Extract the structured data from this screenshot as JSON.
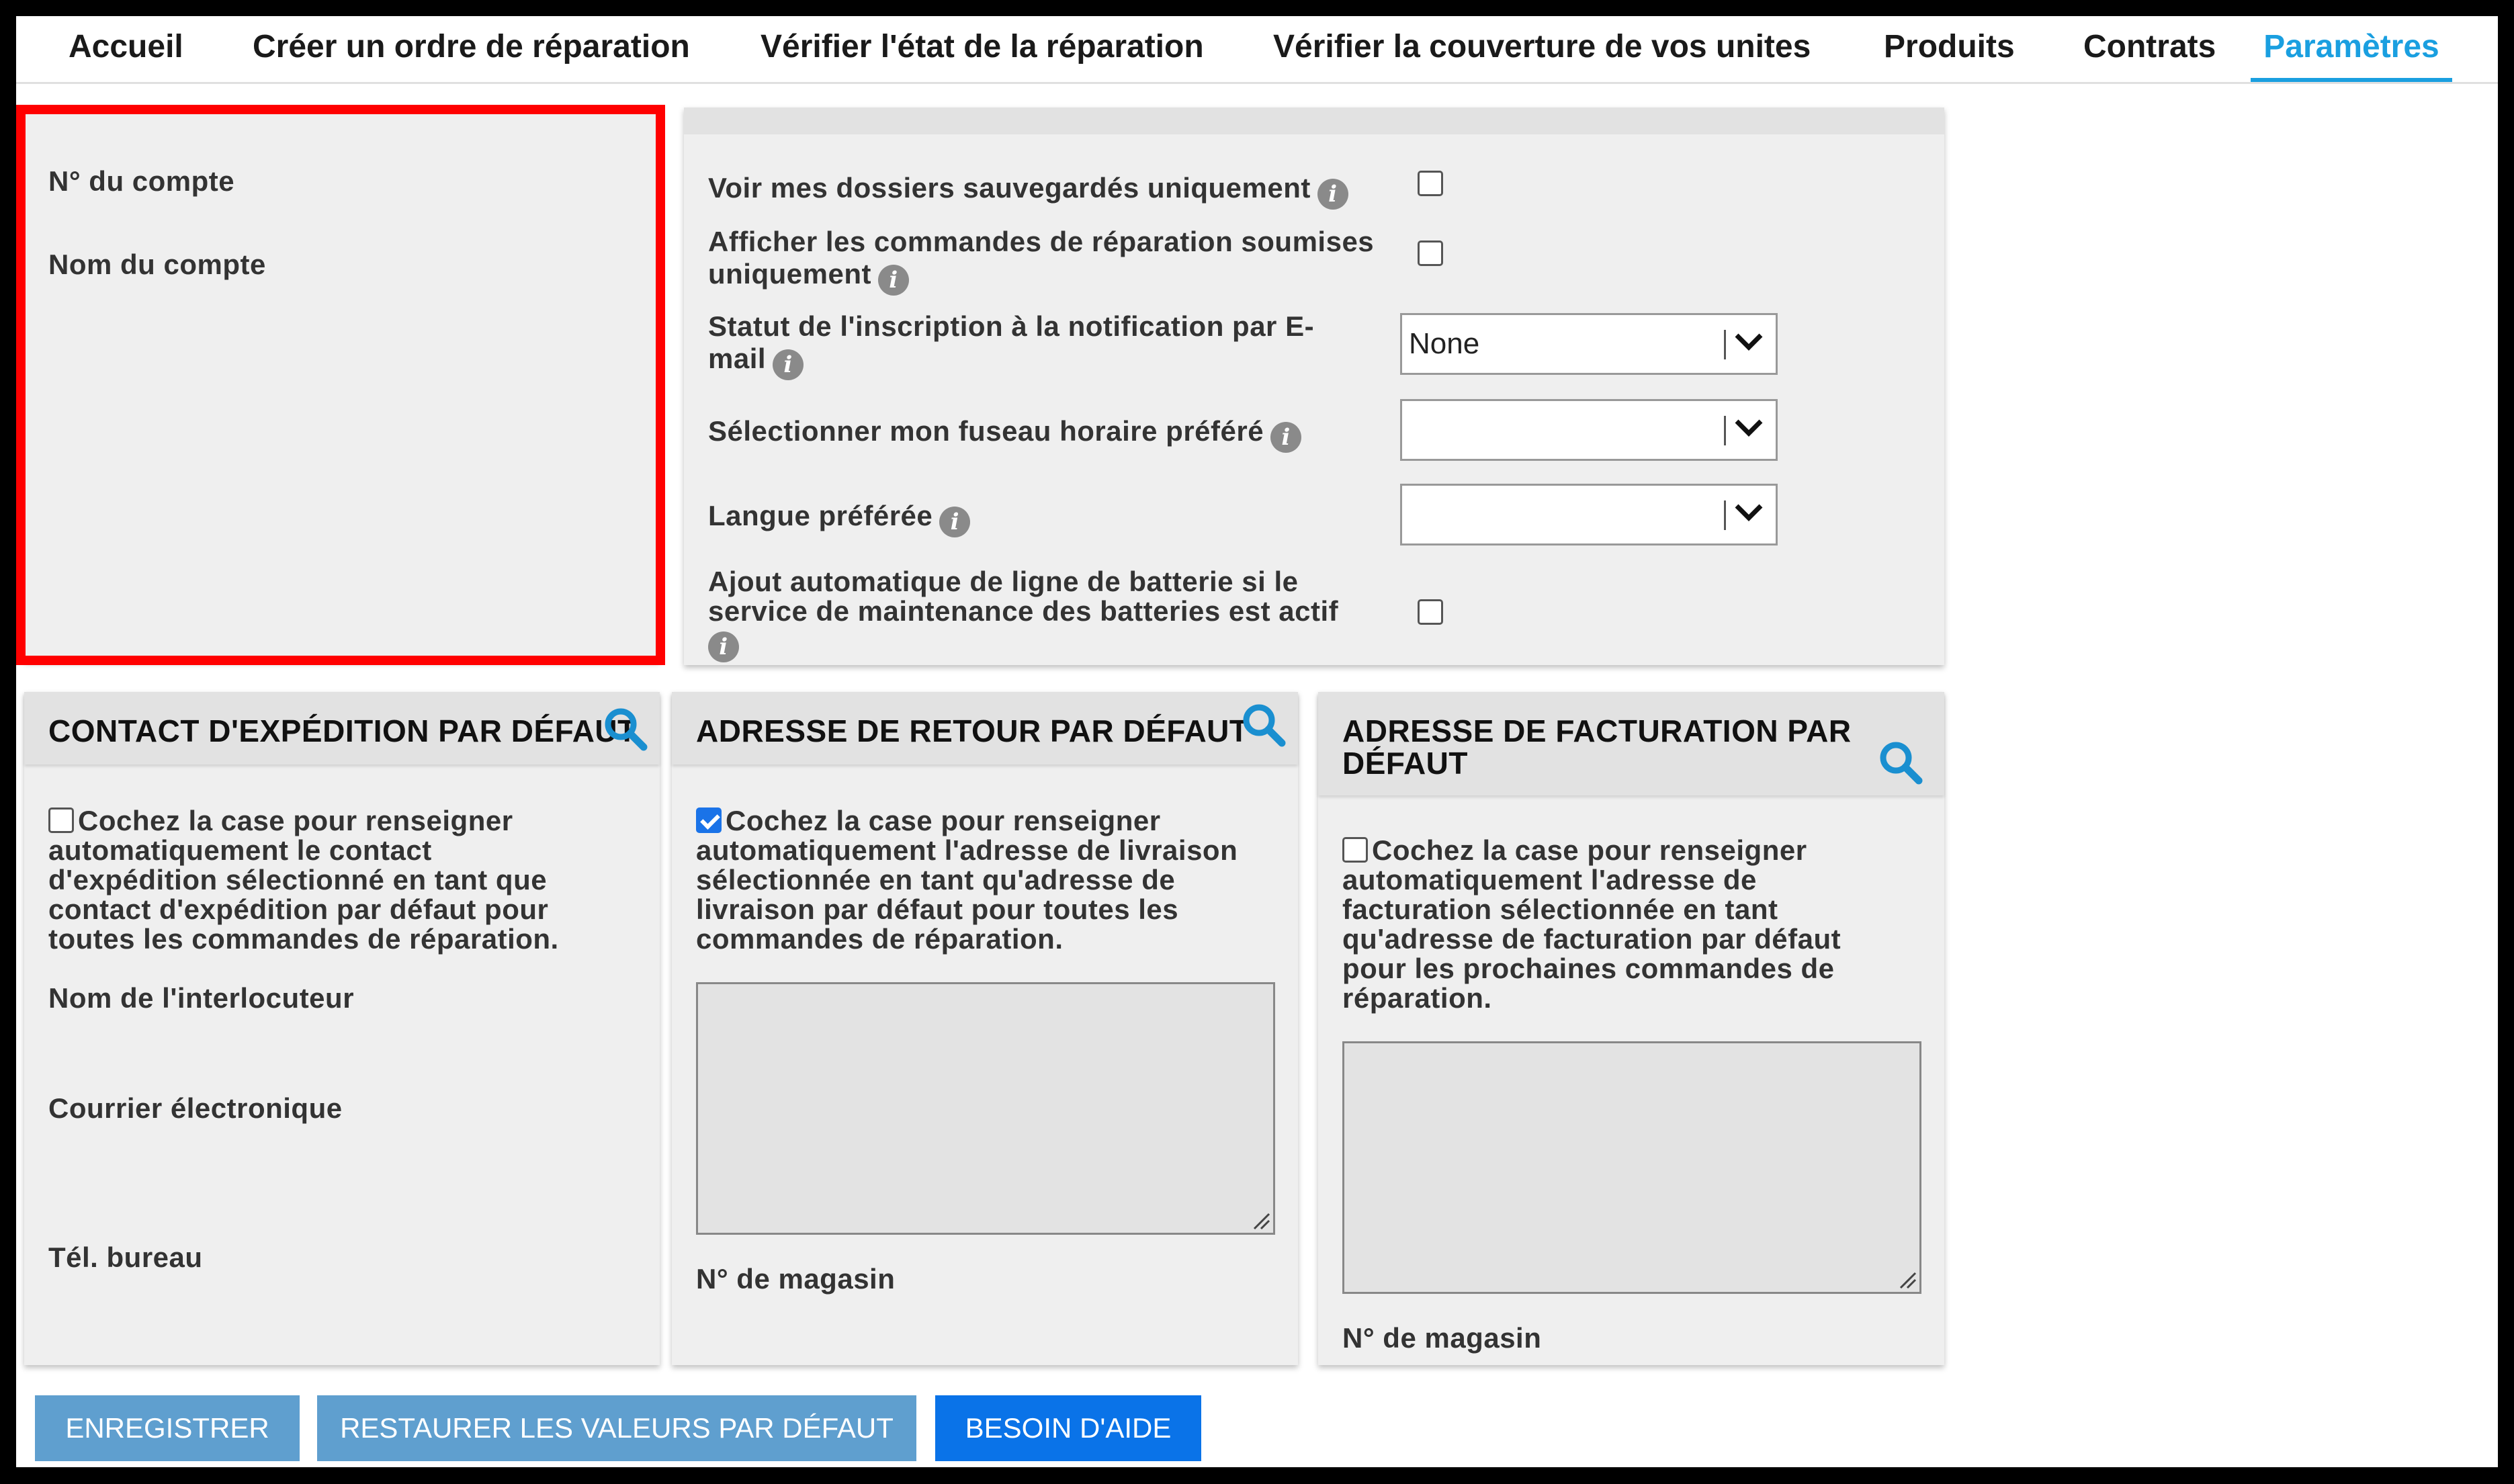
{
  "nav": {
    "tabs": [
      {
        "label": "Accueil",
        "active": false
      },
      {
        "label": "Créer un ordre de réparation",
        "active": false
      },
      {
        "label": "Vérifier l'état de la réparation",
        "active": false
      },
      {
        "label": "Vérifier la couverture de vos unites",
        "active": false
      },
      {
        "label": "Produits",
        "active": false
      },
      {
        "label": "Contrats",
        "active": false
      },
      {
        "label": "Paramètres",
        "active": true
      }
    ]
  },
  "account": {
    "number_label": "N° du compte",
    "name_label": "Nom du compte"
  },
  "preferences": {
    "saved_files_only": {
      "label": "Voir mes dossiers sauvegardés uniquement",
      "checked": false
    },
    "submitted_orders_only": {
      "label_line1": "Afficher les commandes de réparation soumises",
      "label_line2": "uniquement",
      "checked": false
    },
    "email_notification": {
      "label_line1": "Statut de l'inscription à la notification par E-",
      "label_line2": "mail",
      "value": "None"
    },
    "timezone": {
      "label": "Sélectionner mon fuseau horaire préféré",
      "value": ""
    },
    "language": {
      "label": "Langue préférée",
      "value": ""
    },
    "battery_line": {
      "label_line1": "Ajout automatique de ligne de batterie si le",
      "label_line2": "service de maintenance des batteries est actif",
      "checked": false
    }
  },
  "shipping_contact": {
    "title": "CONTACT D'EXPÉDITION PAR DÉFAUT",
    "checkbox_checked": false,
    "description_lines": [
      "Cochez la case pour renseigner",
      "automatiquement le contact",
      "d'expédition sélectionné en tant que",
      "contact d'expédition par défaut pour",
      "toutes les commandes de réparation."
    ],
    "contact_name_label": "Nom de l'interlocuteur",
    "email_label": "Courrier électronique",
    "office_phone_label": "Tél. bureau"
  },
  "return_address": {
    "title": "ADRESSE DE RETOUR PAR DÉFAUT",
    "checkbox_checked": true,
    "description_lines": [
      "Cochez la case pour renseigner",
      "automatiquement l'adresse de livraison",
      "sélectionnée en tant qu'adresse de",
      "livraison par défaut pour toutes les",
      "commandes de réparation."
    ],
    "store_label": "N° de magasin"
  },
  "billing_address": {
    "title_line1": "ADRESSE DE FACTURATION PAR",
    "title_line2": "DÉFAUT",
    "checkbox_checked": false,
    "description_lines": [
      "Cochez la case pour renseigner",
      "automatiquement l'adresse de",
      "facturation sélectionnée en tant",
      "qu'adresse de facturation par défaut",
      "pour les prochaines commandes de",
      "réparation."
    ],
    "store_label": "N° de magasin"
  },
  "buttons": {
    "save": "ENREGISTRER",
    "restore": "RESTAURER LES VALEURS PAR DÉFAUT",
    "help": "BESOIN D'AIDE"
  },
  "colors": {
    "active_tab": "#1a9fe0",
    "highlight_border": "#ff0000",
    "search_icon": "#1a8fd0",
    "button_gray": "#5f9fcf",
    "button_blue": "#0a73e8"
  }
}
